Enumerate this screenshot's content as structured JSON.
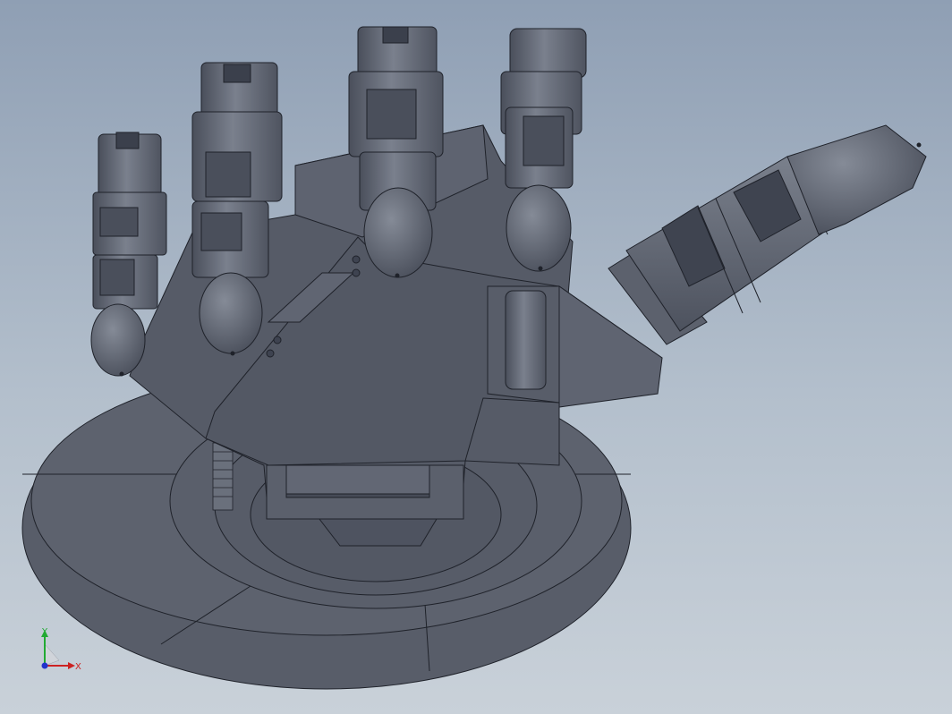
{
  "viewport": {
    "background_top": "#8f9fb4",
    "background_bottom": "#c9d1d9",
    "model_color": "#585d69",
    "model_dark": "#424753",
    "model_light": "#707683",
    "edge_color": "#1f222a"
  },
  "triad": {
    "x_label": "X",
    "y_label": "Y",
    "x_color": "#cc2222",
    "y_color": "#22aa33",
    "z_color": "#2233cc"
  }
}
